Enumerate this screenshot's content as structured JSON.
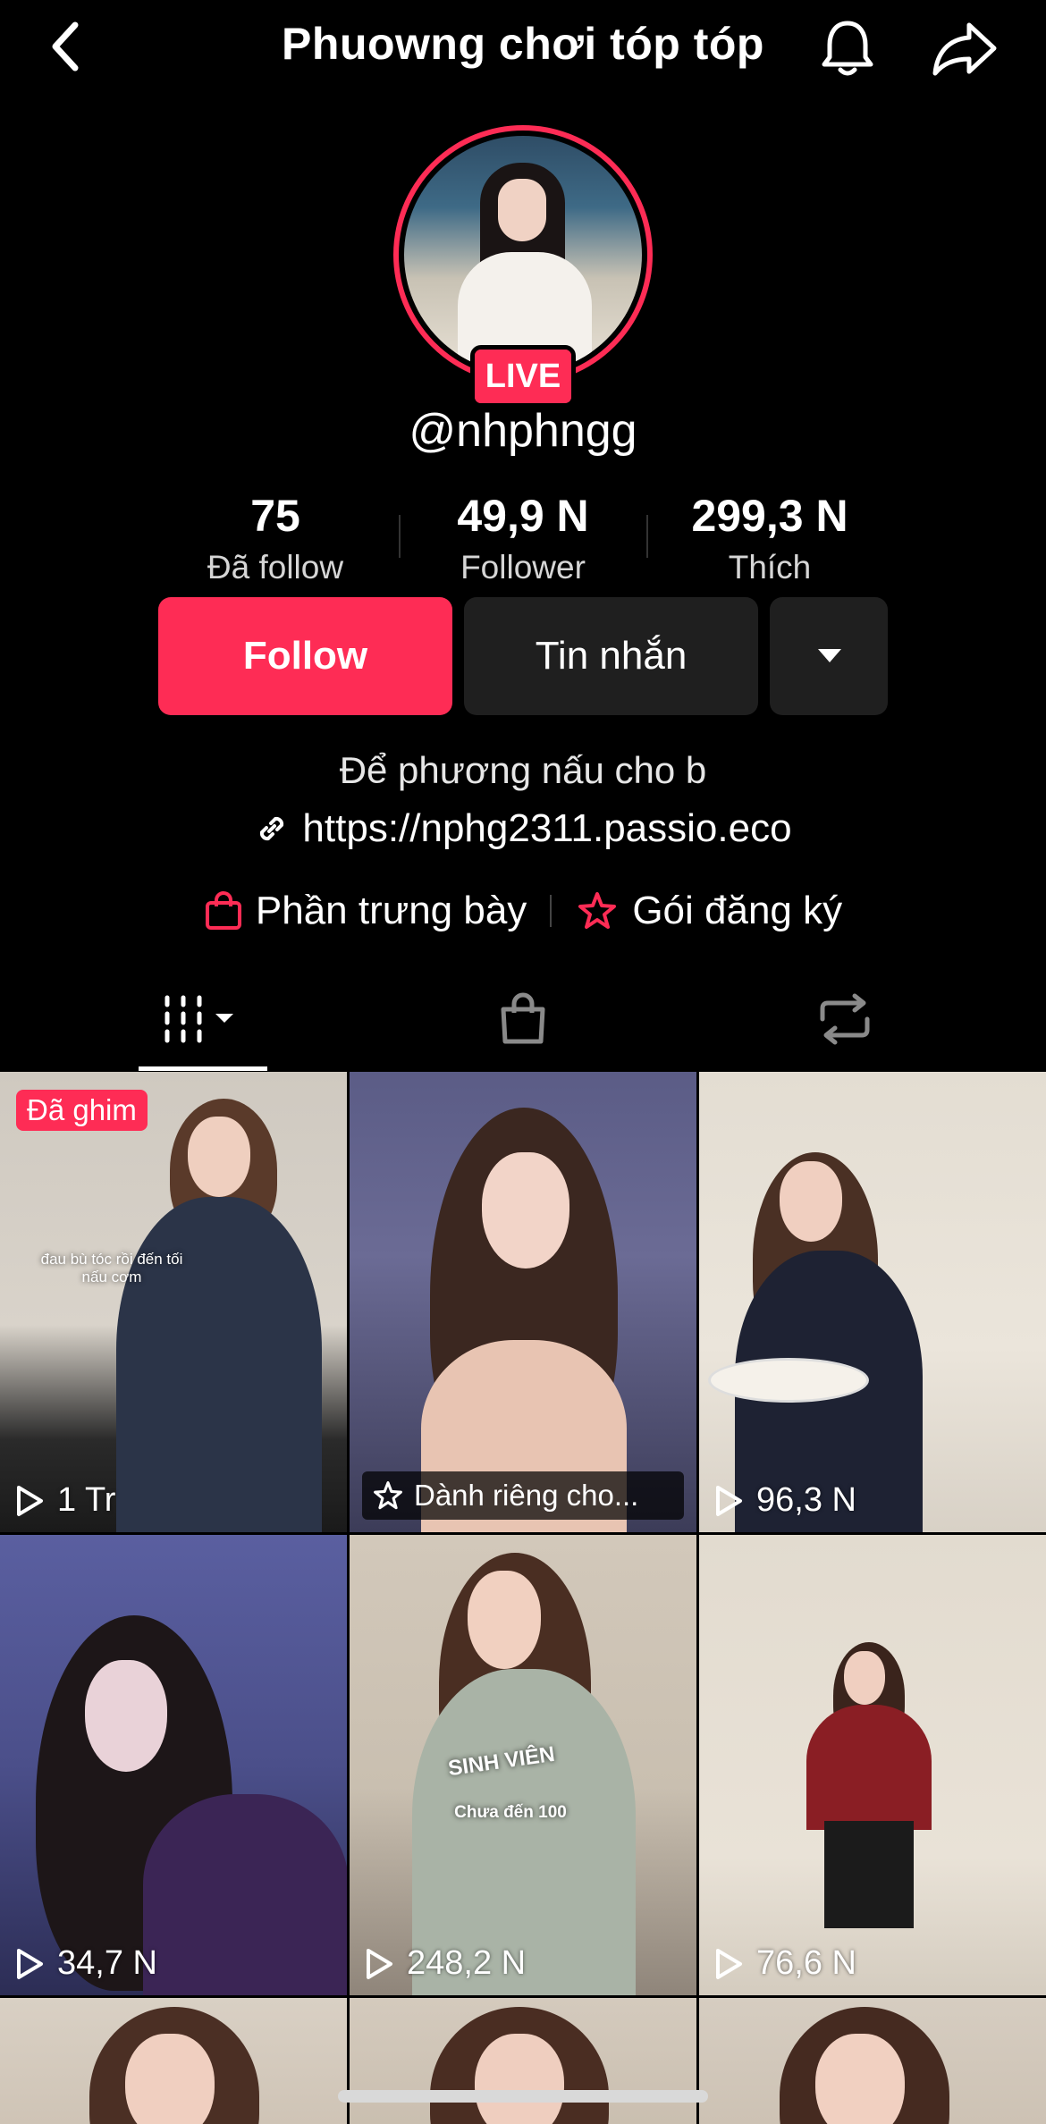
{
  "header": {
    "title": "Phuowng chơi tóp tóp"
  },
  "profile": {
    "live_badge": "LIVE",
    "handle": "@nhphngg",
    "bio": "Để phương nấu cho b",
    "link": "https://nphg2311.passio.eco"
  },
  "stats": [
    {
      "value": "75",
      "label": "Đã follow"
    },
    {
      "value": "49,9 N",
      "label": "Follower"
    },
    {
      "value": "299,3 N",
      "label": "Thích"
    }
  ],
  "actions": {
    "follow_label": "Follow",
    "message_label": "Tin nhắn"
  },
  "shop": {
    "showcase_label": "Phần trưng bày",
    "subscription_label": "Gói đăng ký"
  },
  "colors": {
    "accent": "#fe2c55",
    "background": "#000000",
    "secondary_button": "#1f1f1f"
  },
  "videos": [
    {
      "views": "1 Tr",
      "pinned_label": "Đã ghim",
      "overlay": "đau bù tóc rồi đến tối nấu cơm"
    },
    {
      "caption": "Dành riêng cho..."
    },
    {
      "views": "96,3 N"
    },
    {
      "views": "34,7 N"
    },
    {
      "views": "248,2 N",
      "overlay_top": "SINH VIÊN",
      "overlay_bottom": "Chưa đến 100"
    },
    {
      "views": "76,6 N"
    }
  ]
}
